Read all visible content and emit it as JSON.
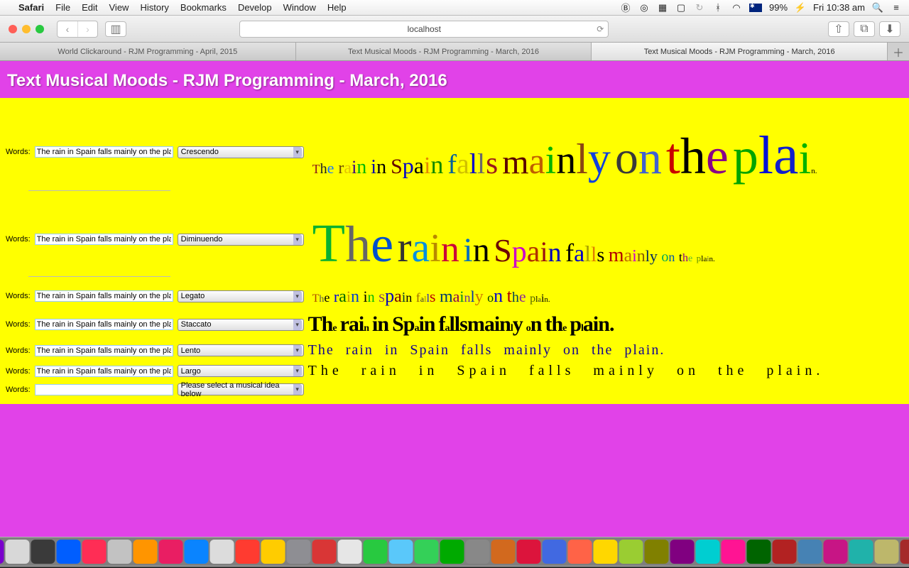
{
  "menubar": {
    "app": "Safari",
    "items": [
      "File",
      "Edit",
      "View",
      "History",
      "Bookmarks",
      "Develop",
      "Window",
      "Help"
    ],
    "battery": "99%",
    "time": "Fri 10:38 am"
  },
  "toolbar": {
    "url": "localhost"
  },
  "tabs": [
    {
      "label": "World Clickaround - RJM Programming - April, 2015",
      "active": false
    },
    {
      "label": "Text Musical Moods - RJM Programming - March, 2016",
      "active": false
    },
    {
      "label": "Text Musical Moods - RJM Programming - March, 2016",
      "active": true
    }
  ],
  "page": {
    "title": "Text Musical Moods - RJM Programming - March, 2016",
    "words_label": "Words:",
    "default_text": "The rain in Spain falls mainly on the plain.",
    "empty_text": "",
    "select_placeholder": "Please select a musical idea below",
    "rows": [
      {
        "mode": "Crescendo"
      },
      {
        "mode": "Diminuendo"
      },
      {
        "mode": "Legato"
      },
      {
        "mode": "Staccato"
      },
      {
        "mode": "Lento"
      },
      {
        "mode": "Largo"
      }
    ],
    "sentence_chars": [
      "T",
      "h",
      "e",
      " ",
      "r",
      "a",
      "i",
      "n",
      " ",
      "i",
      "n",
      " ",
      "S",
      "p",
      "a",
      "i",
      "n",
      " ",
      "f",
      "a",
      "l",
      "l",
      "s",
      " ",
      "m",
      "a",
      "i",
      "n",
      "l",
      "y",
      " ",
      "o",
      "n",
      " ",
      "t",
      "h",
      "e",
      " ",
      "p",
      "l",
      "a",
      "i",
      "n",
      "."
    ],
    "sentence_words": [
      "The",
      "rain",
      "in",
      "Spain",
      "falls",
      "mainly",
      "on",
      "the",
      "plain."
    ]
  },
  "dock_colors": [
    "#3478f6",
    "#555",
    "#1877f2",
    "#d93025",
    "#ff4500",
    "#f7b500",
    "#5ec9f8",
    "#7a00cc",
    "#d8d8d8",
    "#3a3a3a",
    "#005eff",
    "#ff2d55",
    "#c2c2c2",
    "#ff9500",
    "#e91e63",
    "#0a84ff",
    "#dcdcdc",
    "#ff3b30",
    "#ffcc00",
    "#8e8e93",
    "#d93636",
    "#e6e6e6",
    "#28c940",
    "#5ac8fa",
    "#34d058",
    "#0a0",
    "#888",
    "#d2691e",
    "#dc143c",
    "#4169e1",
    "#ff6347",
    "#ffd700",
    "#9acd32",
    "#808000",
    "#800080",
    "#00ced1",
    "#ff1493",
    "#006400",
    "#b22222",
    "#4682b4",
    "#c71585",
    "#20b2aa",
    "#bdb76b",
    "#a52a2a",
    "#556b2f",
    "#2f4f4f",
    "#5b5b5b",
    "#999999",
    "#bbbbbb",
    "#cccccc",
    "#777"
  ]
}
